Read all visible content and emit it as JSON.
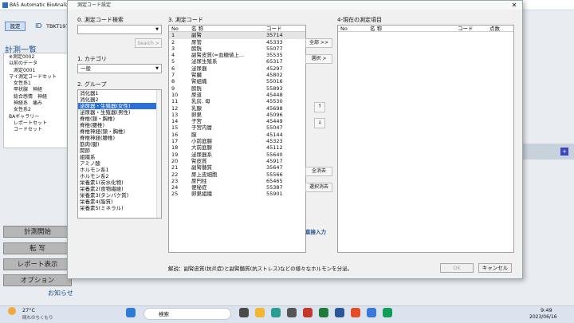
{
  "main": {
    "title": "BA5 Automatic BioAnalizer",
    "set": "設定",
    "id_label": "ID",
    "id_value": "TBKT197",
    "section": "計測一覧",
    "tree": [
      "※測定0002",
      "以前のデータ",
      "測定0001",
      "マイ測定コードセット",
      "女性系1",
      "甲状腺　神経",
      "総合感情　神経",
      "神経系　痛み",
      "女性系2",
      "BAギャラリー",
      "レポートセット",
      "コードセット"
    ],
    "buttons": [
      "計測開始",
      "転 写",
      "レポート表示",
      "オプション"
    ],
    "notice": "お知らせ"
  },
  "dialog": {
    "title": "測定コード設定",
    "close": "✕",
    "search_label": "0. 測定コード検索",
    "search_button": "Search >",
    "category_label": "1. カテゴリ",
    "category_value": "一般",
    "group_label": "2. グループ",
    "groups": [
      "消化器1",
      "消化器2",
      "泌尿器・生殖器(女性)",
      "泌尿器・生殖器(男性)",
      "脊椎(頸・胸椎)",
      "脊椎(腰椎)",
      "脊椎神経(頸・胸椎)",
      "脊椎神経(腰椎)",
      "筋肉(腱)",
      "関節",
      "組織系",
      "アミノ酸",
      "ホルモン系1",
      "ホルモン系2",
      "栄養素1(炭水化物)",
      "栄養素2(食物繊維)",
      "栄養素3(タンパク質)",
      "栄養素4(脂質)",
      "栄養素5(ミネラル)"
    ],
    "codes_label": "3. 測定コード",
    "codes_headers": [
      "No",
      "名 称",
      "コード"
    ],
    "codes": [
      [
        "1",
        "副腎",
        "35714"
      ],
      [
        "2",
        "尿管",
        "45333"
      ],
      [
        "3",
        "膀胱",
        "55077"
      ],
      [
        "4",
        "副腎皮質(=血糖値上...",
        "35535"
      ],
      [
        "5",
        "泌尿生殖系",
        "65317"
      ],
      [
        "6",
        "泌尿器",
        "45297"
      ],
      [
        "7",
        "腎臓",
        "45802"
      ],
      [
        "8",
        "腎組織",
        "55016"
      ],
      [
        "9",
        "膀胱",
        "55893"
      ],
      [
        "10",
        "尿道",
        "45448"
      ],
      [
        "11",
        "乳房, 母",
        "45530"
      ],
      [
        "12",
        "乳腺",
        "45698"
      ],
      [
        "13",
        "卵巣",
        "45096"
      ],
      [
        "14",
        "子宮",
        "45449"
      ],
      [
        "15",
        "子宮内層",
        "55047"
      ],
      [
        "16",
        "膣",
        "45144"
      ],
      [
        "17",
        "小前庭腺",
        "45323"
      ],
      [
        "18",
        "大前庭腺",
        "45112"
      ],
      [
        "19",
        "泌尿器系",
        "55640"
      ],
      [
        "20",
        "腎皮質",
        "45917"
      ],
      [
        "21",
        "副腎髄質",
        "35647"
      ],
      [
        "22",
        "尿上皮細胞",
        "55566"
      ],
      [
        "23",
        "尿円柱",
        "65465"
      ],
      [
        "24",
        "便秘症",
        "55387"
      ],
      [
        "25",
        "卵巣組織",
        "55901"
      ]
    ],
    "btn_add_all": "全部 >>",
    "btn_add": "選択 >",
    "btn_up": "↑",
    "btn_down": "↓",
    "btn_clear_all": "全消去",
    "btn_clear_sel": "選択消去",
    "direct": "直接入力",
    "current_label": "4-現在の測定項目",
    "current_headers": [
      "No",
      "名 称",
      "コード",
      "点数"
    ],
    "description": "解説：副腎皮質(抗炎症)と副腎髄質(抗ストレス)などの様々なホルモンを分泌。",
    "ok": "OK",
    "cancel": "キャンセル"
  },
  "taskbar": {
    "weather_temp": "27°C",
    "weather_desc": "晴れのちくもり",
    "search": "検索",
    "time": "9:49",
    "date": "2023/06/16"
  }
}
